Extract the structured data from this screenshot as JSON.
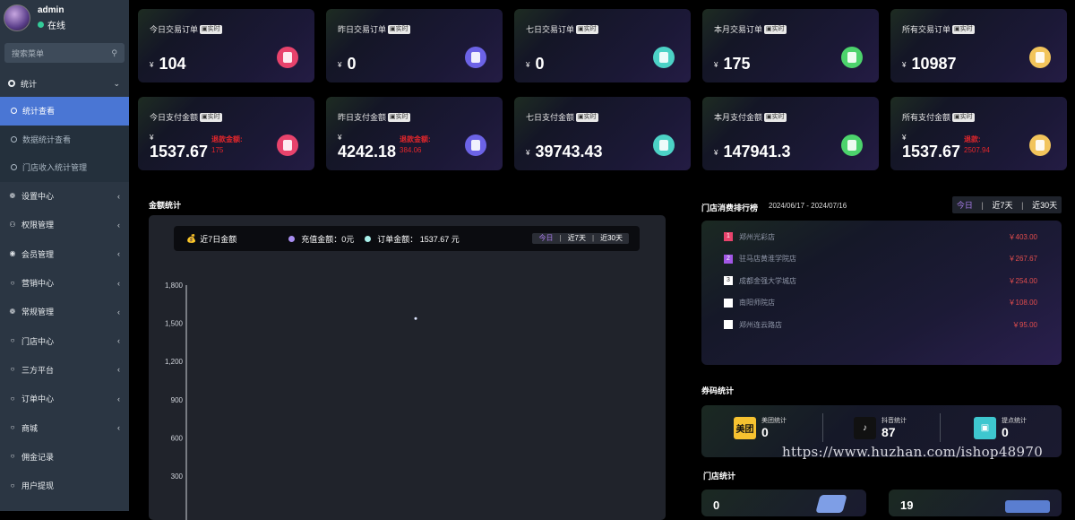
{
  "user": {
    "name": "admin",
    "status": "在线"
  },
  "search": {
    "placeholder": "搜索菜单"
  },
  "menu": {
    "stats": "统计",
    "stats_sub": [
      "统计查看",
      "数据统计查看",
      "门店收入统计管理"
    ],
    "items": [
      {
        "label": "设置中心",
        "icon": "gears-icon"
      },
      {
        "label": "权限管理",
        "icon": "users-icon"
      },
      {
        "label": "会员管理",
        "icon": "user-circle-icon"
      },
      {
        "label": "营销中心",
        "icon": "circle-icon"
      },
      {
        "label": "常规管理",
        "icon": "gears-icon"
      },
      {
        "label": "门店中心",
        "icon": "circle-icon"
      },
      {
        "label": "三方平台",
        "icon": "circle-icon"
      },
      {
        "label": "订单中心",
        "icon": "circle-icon"
      },
      {
        "label": "商城",
        "icon": "circle-icon"
      },
      {
        "label": "佣金记录",
        "icon": "circle-icon"
      },
      {
        "label": "用户提现",
        "icon": "circle-icon"
      }
    ]
  },
  "tag_label": "实时",
  "currency": "¥",
  "order_cards": [
    {
      "title": "今日交易订单",
      "value": "104",
      "color": "#e8436c"
    },
    {
      "title": "昨日交易订单",
      "value": "0",
      "color": "#6c63e6"
    },
    {
      "title": "七日交易订单",
      "value": "0",
      "color": "#4cd2c6"
    },
    {
      "title": "本月交易订单",
      "value": "175",
      "color": "#4cd36c"
    },
    {
      "title": "所有交易订单",
      "value": "10987",
      "color": "#f2c45b"
    }
  ],
  "pay_cards": [
    {
      "title": "今日支付金额",
      "value": "1537.67",
      "refund_label": "退款金额:",
      "refund": "175",
      "color": "#e8436c"
    },
    {
      "title": "昨日支付金额",
      "value": "4242.18",
      "refund_label": "退款金额:",
      "refund": "384.06",
      "color": "#6c63e6"
    },
    {
      "title": "七日支付金额",
      "value": "39743.43",
      "color": "#4cd2c6"
    },
    {
      "title": "本月支付金额",
      "value": "147941.3",
      "color": "#4cd36c"
    },
    {
      "title": "所有支付金额",
      "value": "1537.67",
      "refund_label": "退款:",
      "refund": "2507.94",
      "color": "#f2c45b"
    }
  ],
  "amount_section": {
    "title": "金额统计"
  },
  "chart_legend": {
    "title": "近7日金额",
    "recharge": "充值金额：0元",
    "order": "订单金额：  1537.67 元",
    "tabs": [
      "今日",
      "近7天",
      "近30天"
    ]
  },
  "chart_data": {
    "type": "line",
    "title": "",
    "yticks": [
      1800,
      1500,
      1200,
      900,
      600,
      300
    ],
    "ylim": [
      0,
      1800
    ],
    "series": [
      {
        "values": [
          1537.67
        ]
      }
    ]
  },
  "ranking": {
    "title": "门店消费排行榜",
    "range": "2024/06/17 - 2024/07/16",
    "tabs": [
      "今日",
      "近7天",
      "近30天"
    ],
    "rows": [
      {
        "rank": "1",
        "name": "郑州光彩店",
        "value": "￥403.00",
        "color": "#e8436c"
      },
      {
        "rank": "2",
        "name": "驻马店黄淮学院店",
        "value": "￥267.67",
        "color": "#a257e6"
      },
      {
        "rank": "3",
        "name": "成都金强大学城店",
        "value": "￥254.00",
        "color": "#ffffff"
      },
      {
        "rank": "",
        "name": "南阳师院店",
        "value": "￥108.00",
        "color": "#ffffff"
      },
      {
        "rank": "",
        "name": "郑州连云路店",
        "value": "￥95.00",
        "color": "#ffffff"
      }
    ]
  },
  "coupon": {
    "title": "券码统计",
    "items": [
      {
        "label": "美团统计",
        "logo": "美团",
        "value": "0"
      },
      {
        "label": "抖音统计",
        "logo": "♪",
        "value": "87"
      },
      {
        "label": "提点统计",
        "logo": "",
        "value": "0"
      }
    ]
  },
  "store_stats": {
    "title": "门店统计",
    "values": [
      "0",
      "19"
    ]
  },
  "watermark": "https://www.huzhan.com/ishop48970"
}
